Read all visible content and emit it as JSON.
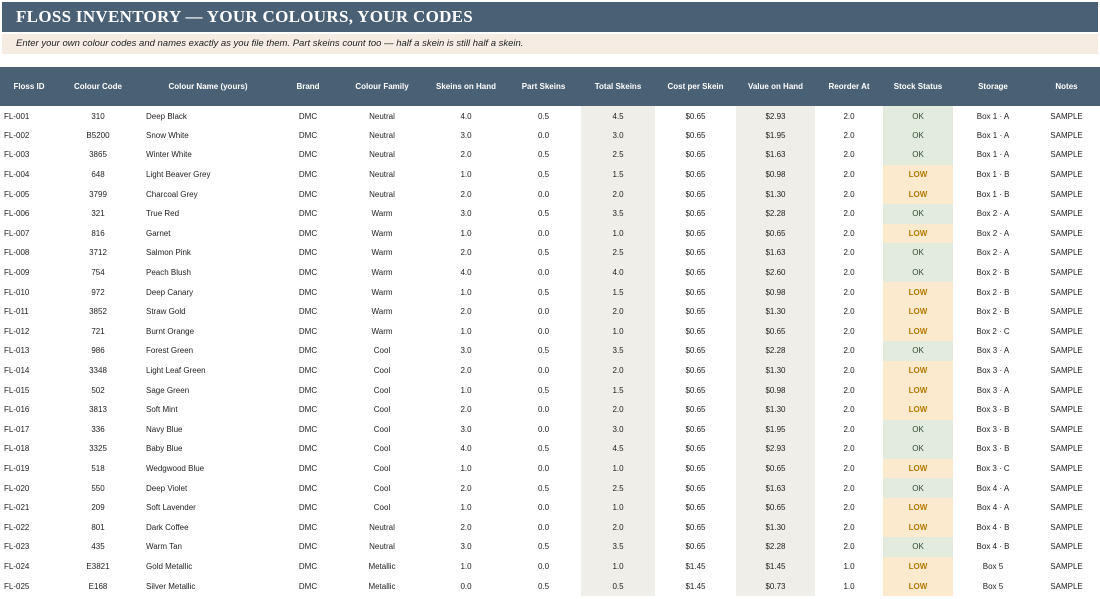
{
  "title": "FLOSS INVENTORY — YOUR COLOURS, YOUR CODES",
  "subtitle": "Enter your own colour codes and names exactly as you file them. Part skeins count too — half a skein is still half a skein.",
  "colors": {
    "header_bg": "#4a6074",
    "subtitle_bg": "#f6ece3",
    "shaded_column": "#efeee9",
    "ok_bg": "#e3ebdf",
    "low_bg": "#fbeacd",
    "low_text": "#b47a00"
  },
  "columns": [
    "Floss ID",
    "Colour Code",
    "Colour Name (yours)",
    "Brand",
    "Colour Family",
    "Skeins on Hand",
    "Part Skeins",
    "Total Skeins",
    "Cost per Skein",
    "Value on Hand",
    "Reorder At",
    "Stock Status",
    "Storage",
    "Notes"
  ],
  "rows": [
    [
      "FL-001",
      "310",
      "Deep Black",
      "DMC",
      "Neutral",
      "4.0",
      "0.5",
      "4.5",
      "$0.65",
      "$2.93",
      "2.0",
      "OK",
      "Box 1 · A",
      "SAMPLE"
    ],
    [
      "FL-002",
      "B5200",
      "Snow White",
      "DMC",
      "Neutral",
      "3.0",
      "0.0",
      "3.0",
      "$0.65",
      "$1.95",
      "2.0",
      "OK",
      "Box 1 · A",
      "SAMPLE"
    ],
    [
      "FL-003",
      "3865",
      "Winter White",
      "DMC",
      "Neutral",
      "2.0",
      "0.5",
      "2.5",
      "$0.65",
      "$1.63",
      "2.0",
      "OK",
      "Box 1 · A",
      "SAMPLE"
    ],
    [
      "FL-004",
      "648",
      "Light Beaver Grey",
      "DMC",
      "Neutral",
      "1.0",
      "0.5",
      "1.5",
      "$0.65",
      "$0.98",
      "2.0",
      "LOW",
      "Box 1 · B",
      "SAMPLE"
    ],
    [
      "FL-005",
      "3799",
      "Charcoal Grey",
      "DMC",
      "Neutral",
      "2.0",
      "0.0",
      "2.0",
      "$0.65",
      "$1.30",
      "2.0",
      "LOW",
      "Box 1 · B",
      "SAMPLE"
    ],
    [
      "FL-006",
      "321",
      "True Red",
      "DMC",
      "Warm",
      "3.0",
      "0.5",
      "3.5",
      "$0.65",
      "$2.28",
      "2.0",
      "OK",
      "Box 2 · A",
      "SAMPLE"
    ],
    [
      "FL-007",
      "816",
      "Garnet",
      "DMC",
      "Warm",
      "1.0",
      "0.0",
      "1.0",
      "$0.65",
      "$0.65",
      "2.0",
      "LOW",
      "Box 2 · A",
      "SAMPLE"
    ],
    [
      "FL-008",
      "3712",
      "Salmon Pink",
      "DMC",
      "Warm",
      "2.0",
      "0.5",
      "2.5",
      "$0.65",
      "$1.63",
      "2.0",
      "OK",
      "Box 2 · A",
      "SAMPLE"
    ],
    [
      "FL-009",
      "754",
      "Peach Blush",
      "DMC",
      "Warm",
      "4.0",
      "0.0",
      "4.0",
      "$0.65",
      "$2.60",
      "2.0",
      "OK",
      "Box 2 · B",
      "SAMPLE"
    ],
    [
      "FL-010",
      "972",
      "Deep Canary",
      "DMC",
      "Warm",
      "1.0",
      "0.5",
      "1.5",
      "$0.65",
      "$0.98",
      "2.0",
      "LOW",
      "Box 2 · B",
      "SAMPLE"
    ],
    [
      "FL-011",
      "3852",
      "Straw Gold",
      "DMC",
      "Warm",
      "2.0",
      "0.0",
      "2.0",
      "$0.65",
      "$1.30",
      "2.0",
      "LOW",
      "Box 2 · B",
      "SAMPLE"
    ],
    [
      "FL-012",
      "721",
      "Burnt Orange",
      "DMC",
      "Warm",
      "1.0",
      "0.0",
      "1.0",
      "$0.65",
      "$0.65",
      "2.0",
      "LOW",
      "Box 2 · C",
      "SAMPLE"
    ],
    [
      "FL-013",
      "986",
      "Forest Green",
      "DMC",
      "Cool",
      "3.0",
      "0.5",
      "3.5",
      "$0.65",
      "$2.28",
      "2.0",
      "OK",
      "Box 3 · A",
      "SAMPLE"
    ],
    [
      "FL-014",
      "3348",
      "Light Leaf Green",
      "DMC",
      "Cool",
      "2.0",
      "0.0",
      "2.0",
      "$0.65",
      "$1.30",
      "2.0",
      "LOW",
      "Box 3 · A",
      "SAMPLE"
    ],
    [
      "FL-015",
      "502",
      "Sage Green",
      "DMC",
      "Cool",
      "1.0",
      "0.5",
      "1.5",
      "$0.65",
      "$0.98",
      "2.0",
      "LOW",
      "Box 3 · A",
      "SAMPLE"
    ],
    [
      "FL-016",
      "3813",
      "Soft Mint",
      "DMC",
      "Cool",
      "2.0",
      "0.0",
      "2.0",
      "$0.65",
      "$1.30",
      "2.0",
      "LOW",
      "Box 3 · B",
      "SAMPLE"
    ],
    [
      "FL-017",
      "336",
      "Navy Blue",
      "DMC",
      "Cool",
      "3.0",
      "0.0",
      "3.0",
      "$0.65",
      "$1.95",
      "2.0",
      "OK",
      "Box 3 · B",
      "SAMPLE"
    ],
    [
      "FL-018",
      "3325",
      "Baby Blue",
      "DMC",
      "Cool",
      "4.0",
      "0.5",
      "4.5",
      "$0.65",
      "$2.93",
      "2.0",
      "OK",
      "Box 3 · B",
      "SAMPLE"
    ],
    [
      "FL-019",
      "518",
      "Wedgwood Blue",
      "DMC",
      "Cool",
      "1.0",
      "0.0",
      "1.0",
      "$0.65",
      "$0.65",
      "2.0",
      "LOW",
      "Box 3 · C",
      "SAMPLE"
    ],
    [
      "FL-020",
      "550",
      "Deep Violet",
      "DMC",
      "Cool",
      "2.0",
      "0.5",
      "2.5",
      "$0.65",
      "$1.63",
      "2.0",
      "OK",
      "Box 4 · A",
      "SAMPLE"
    ],
    [
      "FL-021",
      "209",
      "Soft Lavender",
      "DMC",
      "Cool",
      "1.0",
      "0.0",
      "1.0",
      "$0.65",
      "$0.65",
      "2.0",
      "LOW",
      "Box 4 · A",
      "SAMPLE"
    ],
    [
      "FL-022",
      "801",
      "Dark Coffee",
      "DMC",
      "Neutral",
      "2.0",
      "0.0",
      "2.0",
      "$0.65",
      "$1.30",
      "2.0",
      "LOW",
      "Box 4 · B",
      "SAMPLE"
    ],
    [
      "FL-023",
      "435",
      "Warm Tan",
      "DMC",
      "Neutral",
      "3.0",
      "0.5",
      "3.5",
      "$0.65",
      "$2.28",
      "2.0",
      "OK",
      "Box 4 · B",
      "SAMPLE"
    ],
    [
      "FL-024",
      "E3821",
      "Gold Metallic",
      "DMC",
      "Metallic",
      "1.0",
      "0.0",
      "1.0",
      "$1.45",
      "$1.45",
      "1.0",
      "LOW",
      "Box 5",
      "SAMPLE"
    ],
    [
      "FL-025",
      "E168",
      "Silver Metallic",
      "DMC",
      "Metallic",
      "0.0",
      "0.5",
      "0.5",
      "$1.45",
      "$0.73",
      "1.0",
      "LOW",
      "Box 5",
      "SAMPLE"
    ]
  ]
}
